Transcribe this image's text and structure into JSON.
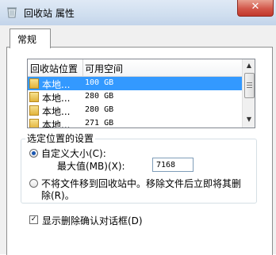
{
  "window": {
    "title": "回收站 属性",
    "close_label": "✕"
  },
  "tabs": [
    {
      "label": "常规"
    }
  ],
  "location_list": {
    "headers": [
      "回收站位置",
      "可用空间"
    ],
    "rows": [
      {
        "location": "本地...",
        "space": "100 GB",
        "selected": true
      },
      {
        "location": "本地...",
        "space": "280 GB",
        "selected": false
      },
      {
        "location": "本地...",
        "space": "280 GB",
        "selected": false
      },
      {
        "location": "本地...",
        "space": "271 GB",
        "selected": false
      }
    ]
  },
  "settings": {
    "group_title": "选定位置的设置",
    "custom_size_label": "自定义大小(C):",
    "custom_size_selected": true,
    "max_label": "最大值(MB)(X):",
    "max_value": "7168",
    "no_move_label_line1": "不将文件移到回收站中。移除文件后立即将其删",
    "no_move_label_line2": "除(R)。",
    "no_move_selected": false
  },
  "confirm_delete": {
    "label": "显示删除确认对话框(D)",
    "checked": true
  },
  "colors": {
    "selection": "#3399ff",
    "close_button": "#c2382c"
  },
  "icons": [
    "recycle-bin-icon",
    "drive-icon",
    "close-icon"
  ]
}
